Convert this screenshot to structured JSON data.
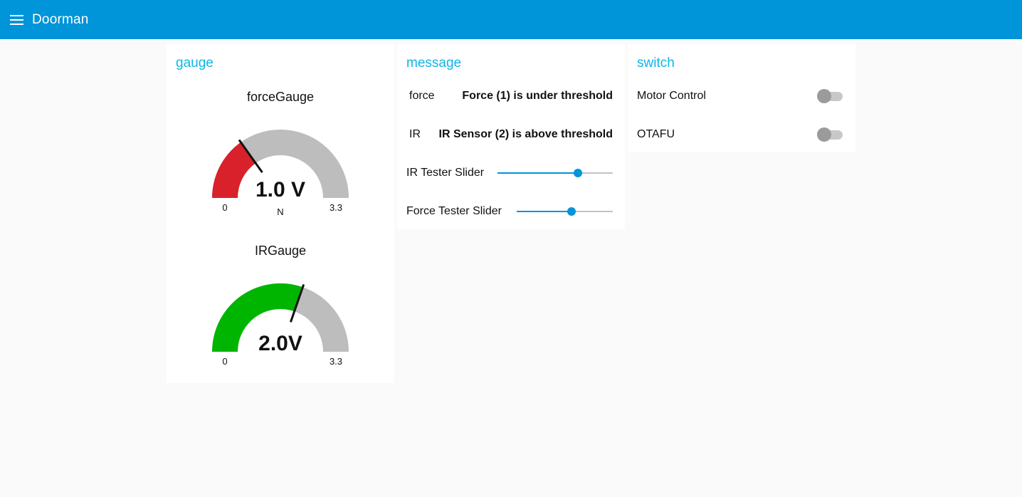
{
  "header": {
    "title": "Doorman"
  },
  "cards": {
    "gauge": {
      "title": "gauge",
      "gauges": [
        {
          "label": "forceGauge",
          "value_text": "1.0 V",
          "value": 1.0,
          "min": 0,
          "max": 3.3,
          "min_text": "0",
          "max_text": "3.3",
          "unit": "N",
          "color": "#d8212a"
        },
        {
          "label": "IRGauge",
          "value_text": "2.0V",
          "value": 2.0,
          "min": 0,
          "max": 3.3,
          "min_text": "0",
          "max_text": "3.3",
          "unit": "",
          "color": "#00b500"
        }
      ]
    },
    "message": {
      "title": "message",
      "rows": [
        {
          "label": "force",
          "value": "Force (1) is under threshold"
        },
        {
          "label": "IR",
          "value": "IR Sensor (2) is above threshold"
        }
      ],
      "sliders": [
        {
          "label": "IR Tester Slider",
          "fraction": 0.7
        },
        {
          "label": "Force Tester Slider",
          "fraction": 0.57
        }
      ]
    },
    "switch": {
      "title": "switch",
      "switches": [
        {
          "label": "Motor Control",
          "on": false
        },
        {
          "label": "OTAFU",
          "on": false
        }
      ]
    }
  },
  "colors": {
    "accent": "#0094d9",
    "title": "#0fb6e6",
    "gauge_track": "#bdbdbd"
  },
  "icons": {
    "menu": "hamburger-menu-icon"
  }
}
